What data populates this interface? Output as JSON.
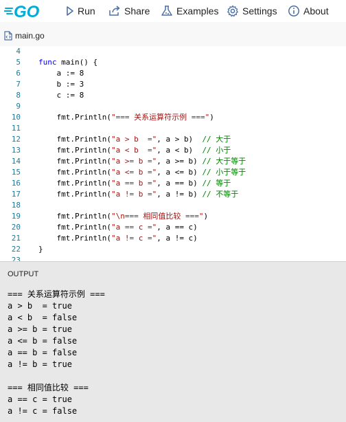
{
  "nav": {
    "logo_text": "GO",
    "run_label": "Run",
    "share_label": "Share",
    "examples_label": "Examples",
    "settings_label": "Settings",
    "about_label": "About"
  },
  "tab": {
    "filename": "main.go"
  },
  "editor": {
    "lines": [
      {
        "num": "4",
        "segments": []
      },
      {
        "num": "5",
        "segments": [
          {
            "t": "func",
            "c": "kw"
          },
          {
            "t": " main() {",
            "c": "op"
          }
        ]
      },
      {
        "num": "6",
        "segments": [
          {
            "t": "    a := ",
            "c": "op"
          },
          {
            "t": "8",
            "c": "op"
          }
        ]
      },
      {
        "num": "7",
        "segments": [
          {
            "t": "    b := ",
            "c": "op"
          },
          {
            "t": "3",
            "c": "op"
          }
        ]
      },
      {
        "num": "8",
        "segments": [
          {
            "t": "    c := ",
            "c": "op"
          },
          {
            "t": "8",
            "c": "op"
          }
        ]
      },
      {
        "num": "9",
        "segments": []
      },
      {
        "num": "10",
        "segments": [
          {
            "t": "    fmt.Println(",
            "c": "op"
          },
          {
            "t": "\"=== 关系运算符示例 ===\"",
            "c": "str"
          },
          {
            "t": ")",
            "c": "op"
          }
        ]
      },
      {
        "num": "11",
        "segments": []
      },
      {
        "num": "12",
        "segments": [
          {
            "t": "    fmt.Println(",
            "c": "op"
          },
          {
            "t": "\"a > b  =\"",
            "c": "str"
          },
          {
            "t": ", a > b)  ",
            "c": "op"
          },
          {
            "t": "// 大于",
            "c": "cm"
          }
        ]
      },
      {
        "num": "13",
        "segments": [
          {
            "t": "    fmt.Println(",
            "c": "op"
          },
          {
            "t": "\"a < b  =\"",
            "c": "str"
          },
          {
            "t": ", a < b)  ",
            "c": "op"
          },
          {
            "t": "// 小于",
            "c": "cm"
          }
        ]
      },
      {
        "num": "14",
        "segments": [
          {
            "t": "    fmt.Println(",
            "c": "op"
          },
          {
            "t": "\"a >= b =\"",
            "c": "str"
          },
          {
            "t": ", a >= b) ",
            "c": "op"
          },
          {
            "t": "// 大于等于",
            "c": "cm"
          }
        ]
      },
      {
        "num": "15",
        "segments": [
          {
            "t": "    fmt.Println(",
            "c": "op"
          },
          {
            "t": "\"a <= b =\"",
            "c": "str"
          },
          {
            "t": ", a <= b) ",
            "c": "op"
          },
          {
            "t": "// 小于等于",
            "c": "cm"
          }
        ]
      },
      {
        "num": "16",
        "segments": [
          {
            "t": "    fmt.Println(",
            "c": "op"
          },
          {
            "t": "\"a == b =\"",
            "c": "str"
          },
          {
            "t": ", a == b) ",
            "c": "op"
          },
          {
            "t": "// 等于",
            "c": "cm"
          }
        ]
      },
      {
        "num": "17",
        "segments": [
          {
            "t": "    fmt.Println(",
            "c": "op"
          },
          {
            "t": "\"a != b =\"",
            "c": "str"
          },
          {
            "t": ", a != b) ",
            "c": "op"
          },
          {
            "t": "// 不等于",
            "c": "cm"
          }
        ]
      },
      {
        "num": "18",
        "segments": []
      },
      {
        "num": "19",
        "segments": [
          {
            "t": "    fmt.Println(",
            "c": "op"
          },
          {
            "t": "\"\\n=== 相同值比较 ===\"",
            "c": "str"
          },
          {
            "t": ")",
            "c": "op"
          }
        ]
      },
      {
        "num": "20",
        "segments": [
          {
            "t": "    fmt.Println(",
            "c": "op"
          },
          {
            "t": "\"a == c =\"",
            "c": "str"
          },
          {
            "t": ", a == c)",
            "c": "op"
          }
        ]
      },
      {
        "num": "21",
        "segments": [
          {
            "t": "    fmt.Println(",
            "c": "op"
          },
          {
            "t": "\"a != c =\"",
            "c": "str"
          },
          {
            "t": ", a != c)",
            "c": "op"
          }
        ]
      },
      {
        "num": "22",
        "segments": [
          {
            "t": "}",
            "c": "op"
          }
        ]
      },
      {
        "num": "23",
        "segments": []
      }
    ]
  },
  "output": {
    "title": "OUTPUT",
    "lines": [
      "=== 关系运算符示例 ===",
      "a > b  = true",
      "a < b  = false",
      "a >= b = true",
      "a <= b = false",
      "a == b = false",
      "a != b = true",
      "",
      "=== 相同值比较 ===",
      "a == c = true",
      "a != c = false"
    ]
  },
  "colors": {
    "brand": "#00add8",
    "keyword": "#0000ff",
    "string": "#a31515",
    "comment": "#008000",
    "line_number": "#237893",
    "output_bg": "#e8e8e8"
  }
}
